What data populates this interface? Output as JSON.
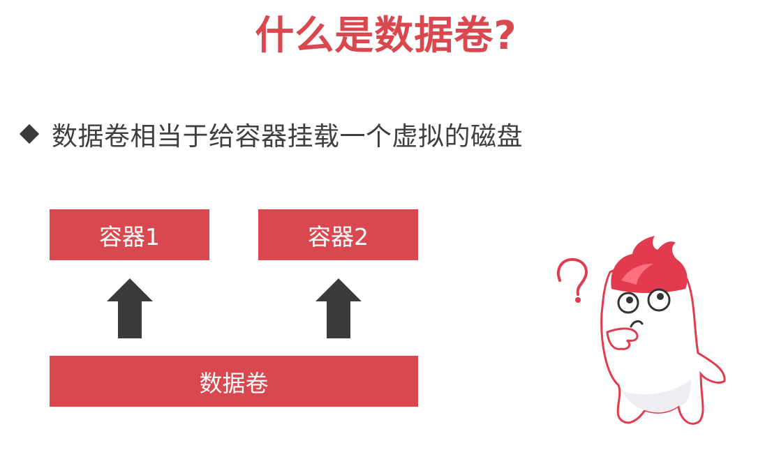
{
  "title": "什么是数据卷?",
  "bullet": {
    "icon": "diamond-bullet-icon",
    "text": "数据卷相当于给容器挂载一个虚拟的磁盘"
  },
  "diagram": {
    "containers": [
      {
        "label": "容器1"
      },
      {
        "label": "容器2"
      }
    ],
    "volume": {
      "label": "数据卷"
    },
    "arrow_icon": "up-arrow-icon"
  },
  "mascot": {
    "icon": "confused-mascot-icon"
  },
  "colors": {
    "accent": "#d9474f",
    "text": "#3f3f3f",
    "arrow": "#3a3a3a",
    "background": "#ffffff"
  }
}
